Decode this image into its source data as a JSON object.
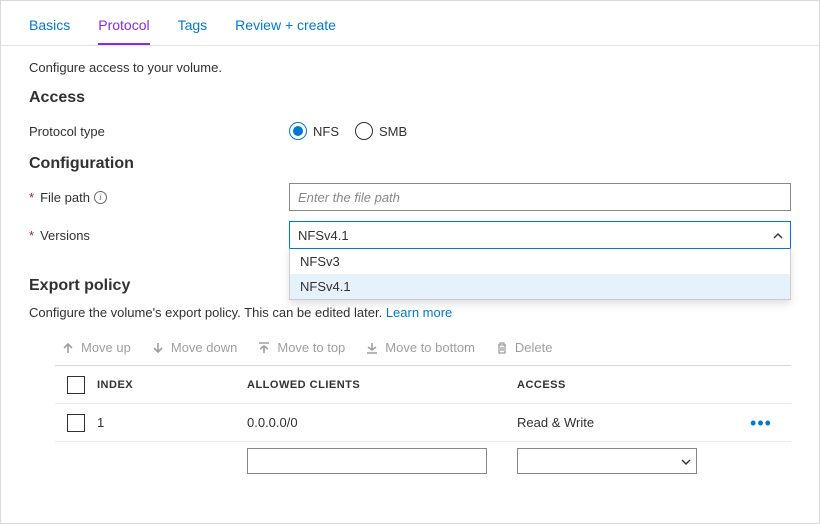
{
  "tabs": {
    "basics": "Basics",
    "protocol": "Protocol",
    "tags": "Tags",
    "review": "Review + create",
    "active": "protocol"
  },
  "intro": "Configure access to your volume.",
  "sections": {
    "access": "Access",
    "configuration": "Configuration",
    "export": "Export policy"
  },
  "fields": {
    "protocol_type_label": "Protocol type",
    "protocol_options": {
      "nfs": "NFS",
      "smb": "SMB"
    },
    "protocol_selected": "nfs",
    "file_path_label": "File path",
    "file_path_placeholder": "Enter the file path",
    "file_path_value": "",
    "versions_label": "Versions",
    "versions_selected": "NFSv4.1",
    "versions_options": [
      "NFSv3",
      "NFSv4.1"
    ]
  },
  "export_policy": {
    "desc": "Configure the volume's export policy. This can be edited later.  ",
    "learn_more": "Learn more",
    "toolbar": {
      "move_up": "Move up",
      "move_down": "Move down",
      "move_top": "Move to top",
      "move_bottom": "Move to bottom",
      "delete": "Delete"
    },
    "columns": {
      "index": "Index",
      "allowed": "Allowed clients",
      "access": "Access"
    },
    "rows": [
      {
        "index": "1",
        "allowed": "0.0.0.0/0",
        "access": "Read & Write"
      }
    ],
    "editor": {
      "allowed_value": "",
      "access_value": ""
    }
  }
}
